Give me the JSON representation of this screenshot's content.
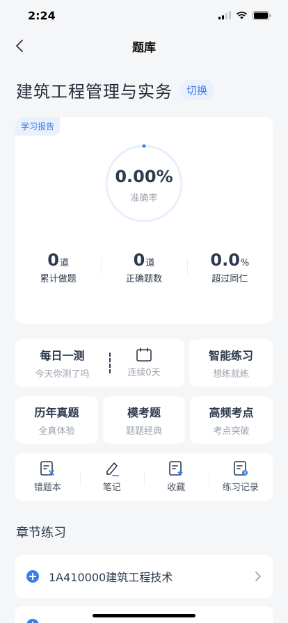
{
  "status_bar": {
    "time": "2:24"
  },
  "nav": {
    "title": "题库"
  },
  "subject": {
    "title": "建筑工程管理与实务",
    "switch_label": "切换"
  },
  "report": {
    "tag": "学习报告",
    "accuracy_value": "0.00%",
    "accuracy_label": "准确率",
    "accuracy_fraction": 0,
    "stats": [
      {
        "value": "0",
        "unit": "道",
        "label": "累计做题"
      },
      {
        "value": "0",
        "unit": "道",
        "label": "正确题数"
      },
      {
        "value": "0.0",
        "unit": "%",
        "label": "超过同仁"
      }
    ]
  },
  "daily": {
    "title": "每日一测",
    "subtitle": "今天你测了吗",
    "streak_label": "连续0天"
  },
  "smart": {
    "title": "智能练习",
    "subtitle": "想练就练"
  },
  "modes": [
    {
      "title": "历年真题",
      "subtitle": "全真体验"
    },
    {
      "title": "模考题",
      "subtitle": "题题经典"
    },
    {
      "title": "高频考点",
      "subtitle": "考点突破"
    }
  ],
  "tools": [
    {
      "label": "错题本",
      "icon": "wrong-book-icon"
    },
    {
      "label": "笔记",
      "icon": "note-pen-icon"
    },
    {
      "label": "收藏",
      "icon": "favorite-icon"
    },
    {
      "label": "练习记录",
      "icon": "practice-record-icon"
    }
  ],
  "section": {
    "title": "章节练习"
  },
  "chapters": [
    {
      "label": "1A410000建筑工程技术"
    }
  ],
  "colors": {
    "accent": "#3b7ee6",
    "background": "#f5f6f8",
    "text_dark": "#2c3a4d",
    "text_muted": "#9aa2ad"
  }
}
